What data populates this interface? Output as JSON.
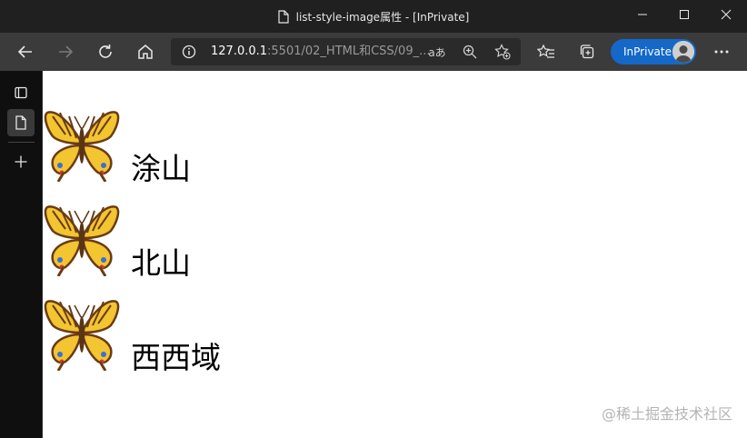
{
  "window": {
    "title": "list-style-image属性 - [InPrivate]"
  },
  "toolbar": {
    "url_host": "127.0.0.1",
    "url_rest": ":5501/02_HTML和CSS/09_...",
    "read_aloud_label": "aあ",
    "inprivate_label": "InPrivate"
  },
  "content": {
    "items": [
      {
        "text": "涂山"
      },
      {
        "text": "北山"
      },
      {
        "text": "西西域"
      }
    ],
    "watermark": "@稀土掘金技术社区"
  },
  "colors": {
    "titlebar": "#202020",
    "toolbar": "#3b3b3b",
    "accent": "#1468c8",
    "butterfly_wing": "#f2c531",
    "butterfly_edge": "#6b3b14"
  }
}
